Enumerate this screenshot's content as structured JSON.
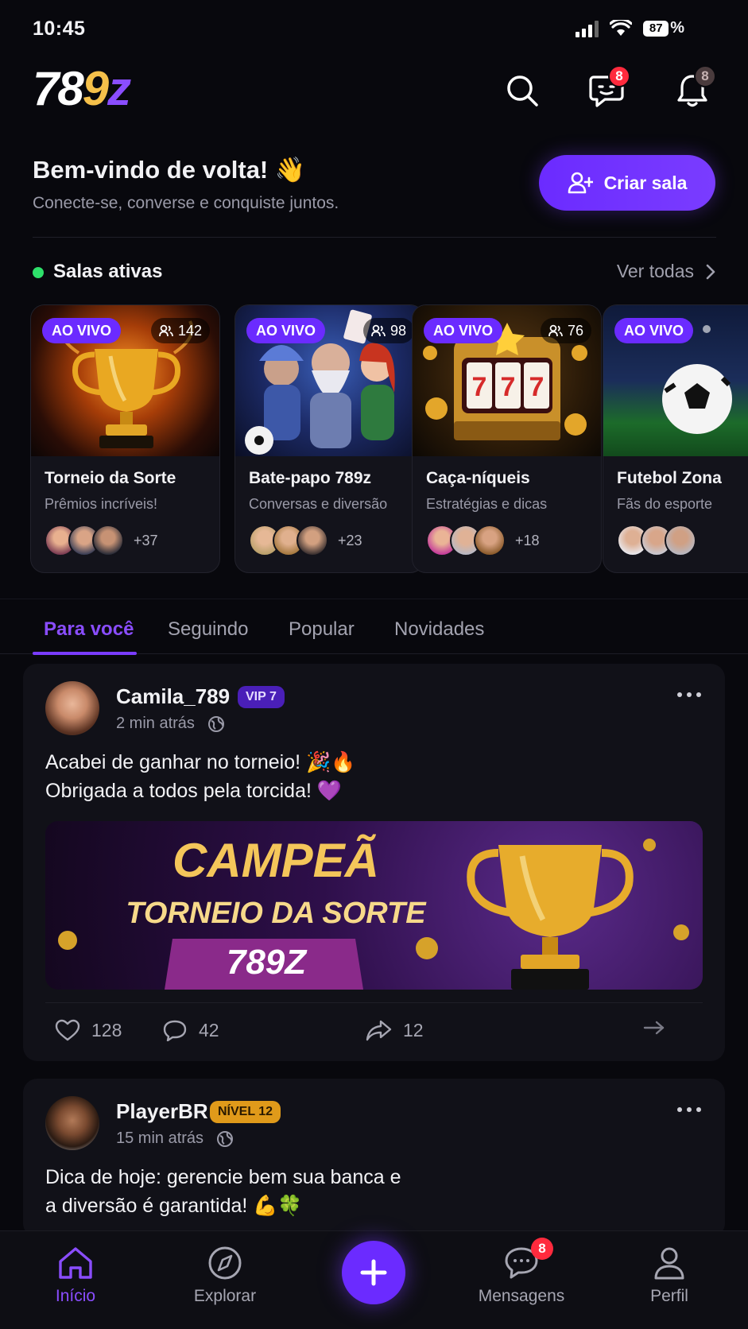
{
  "status": {
    "time": "10:45",
    "battery": "87"
  },
  "header": {
    "logo_parts": [
      "78",
      "9",
      "z"
    ],
    "messages_badge": "8",
    "notifications_badge": "8"
  },
  "welcome": {
    "title": "Bem-vindo de volta! 👋",
    "subtitle": "Conecte-se, converse e conquiste juntos.",
    "create_room_label": "Criar sala"
  },
  "rooms_section": {
    "title": "Salas ativas",
    "see_all": "Ver todas",
    "rooms": [
      {
        "live": "AO VIVO",
        "viewers": "142",
        "name": "Torneio da Sorte",
        "desc": "Prêmios incríveis!",
        "more": "+37"
      },
      {
        "live": "AO VIVO",
        "viewers": "98",
        "name": "Bate-papo 789z",
        "desc": "Conversas e diversão",
        "more": "+23"
      },
      {
        "live": "AO VIVO",
        "viewers": "76",
        "name": "Caça-níqueis",
        "desc": "Estratégias e dicas",
        "more": "+18"
      },
      {
        "live": "AO VIVO",
        "viewers": "",
        "name": "Futebol Zona",
        "desc": "Fãs do esporte",
        "more": ""
      }
    ]
  },
  "tabs": [
    "Para você",
    "Seguindo",
    "Popular",
    "Novidades"
  ],
  "posts": [
    {
      "user": "Camila_789",
      "badge": "VIP 7",
      "time": "2 min atrás",
      "line1": "Acabei de ganhar no torneio! 🎉🔥",
      "line2": "Obrigada a todos pela torcida! 💜",
      "banner": {
        "title": "CAMPEÃ",
        "subtitle": "TORNEIO DA SORTE",
        "brand": "789Z"
      },
      "likes": "128",
      "comments": "42",
      "shares": "12"
    },
    {
      "user": "PlayerBR",
      "badge": "NÍVEL 12",
      "time": "15 min atrás",
      "line1": "Dica de hoje: gerencie bem sua banca e",
      "line2": "a diversão é garantida! 💪🍀"
    }
  ],
  "nav": {
    "home": "Início",
    "explore": "Explorar",
    "messages": "Mensagens",
    "messages_badge": "8",
    "profile": "Perfil"
  },
  "colors": {
    "accent": "#6b2bff",
    "live_dot": "#2ee06a",
    "badge_red": "#ff2a3d",
    "gold": "#f5c04a"
  }
}
